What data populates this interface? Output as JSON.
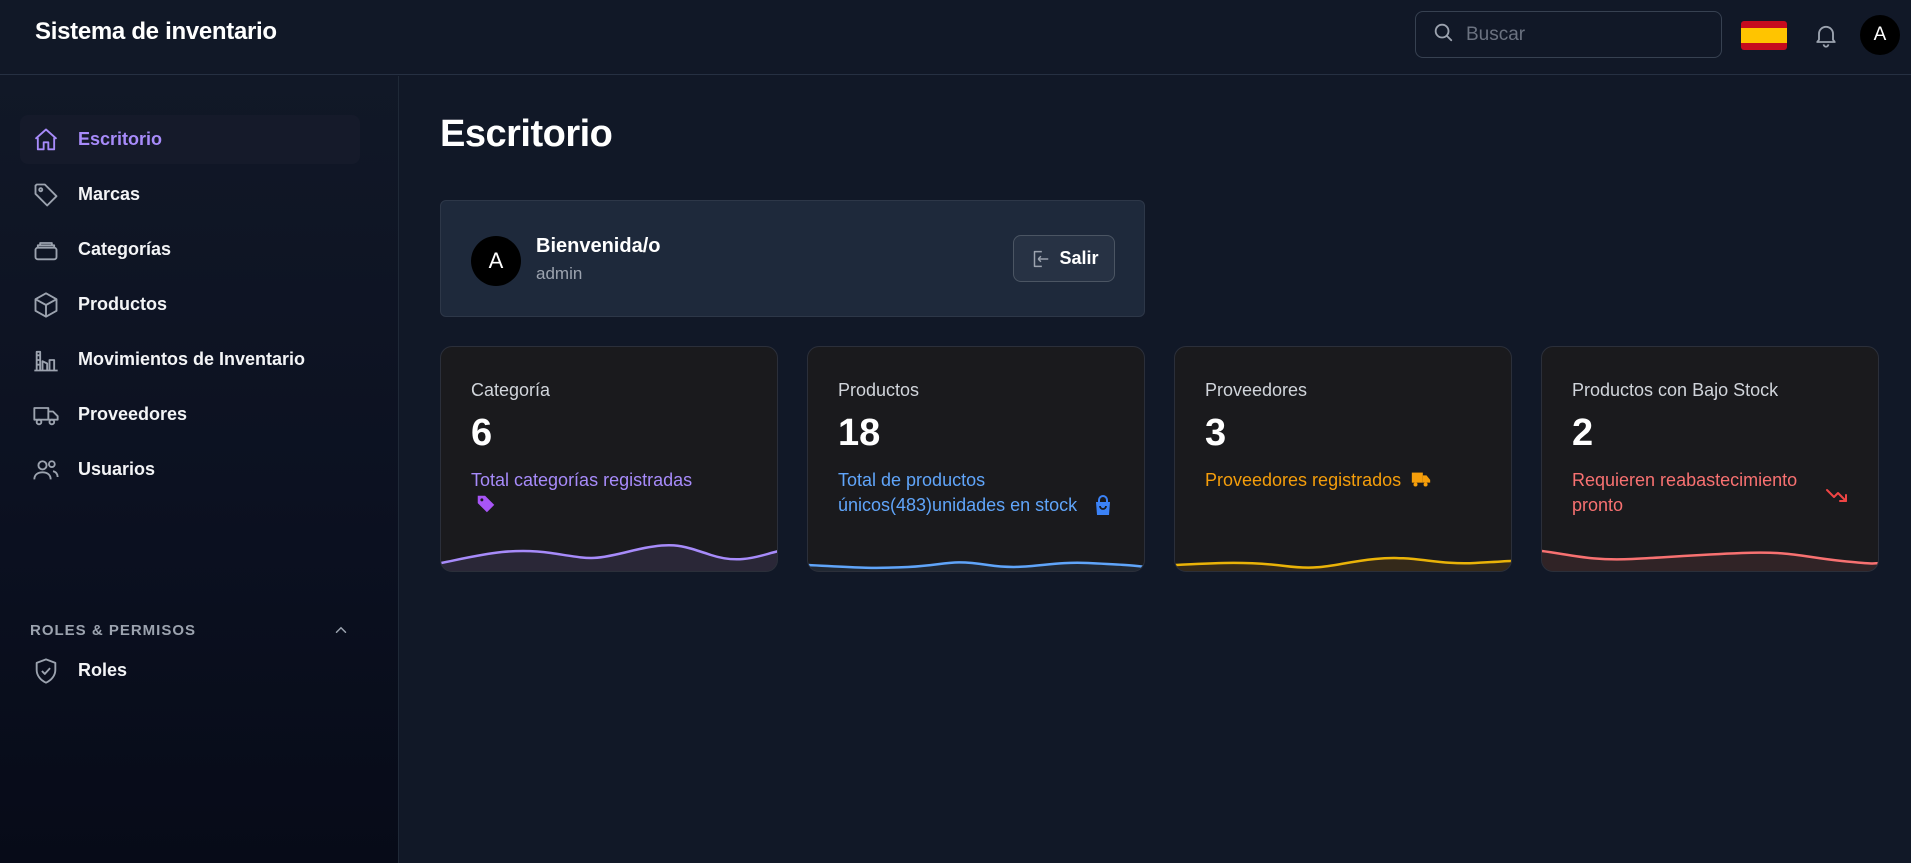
{
  "header": {
    "app_title": "Sistema de inventario",
    "search_placeholder": "Buscar",
    "flag": "spain-flag",
    "avatar_initial": "A"
  },
  "sidebar": {
    "items": [
      {
        "label": "Escritorio",
        "icon": "home-icon",
        "active": true
      },
      {
        "label": "Marcas",
        "icon": "tag-icon"
      },
      {
        "label": "Categorías",
        "icon": "stack-icon"
      },
      {
        "label": "Productos",
        "icon": "cube-icon"
      },
      {
        "label": "Movimientos de Inventario",
        "icon": "building-chart-icon"
      },
      {
        "label": "Proveedores",
        "icon": "truck-icon"
      },
      {
        "label": "Usuarios",
        "icon": "users-icon"
      }
    ],
    "section": {
      "title": "ROLES & PERMISOS",
      "expanded": true
    },
    "section_items": [
      {
        "label": "Roles",
        "icon": "shield-check-icon"
      }
    ]
  },
  "main": {
    "page_title": "Escritorio",
    "welcome": {
      "avatar_initial": "A",
      "greeting": "Bienvenida/o",
      "username": "admin",
      "logout_label": "Salir"
    },
    "cards": [
      {
        "label": "Categoría",
        "value": "6",
        "desc": "Total categorías registradas",
        "icon": "tag-solid-icon",
        "color": "#a78bfa"
      },
      {
        "label": "Productos",
        "value": "18",
        "desc": "Total de productos únicos(483)unidades en stock",
        "icon": "shopping-bag-icon",
        "color": "#60a5fa"
      },
      {
        "label": "Proveedores",
        "value": "3",
        "desc": "Proveedores registrados",
        "icon": "truck-solid-icon",
        "color": "#f59e0b"
      },
      {
        "label": "Productos con Bajo Stock",
        "value": "2",
        "desc": "Requieren reabastecimiento pronto",
        "icon": "trend-down-icon",
        "color": "#f87171"
      }
    ]
  }
}
